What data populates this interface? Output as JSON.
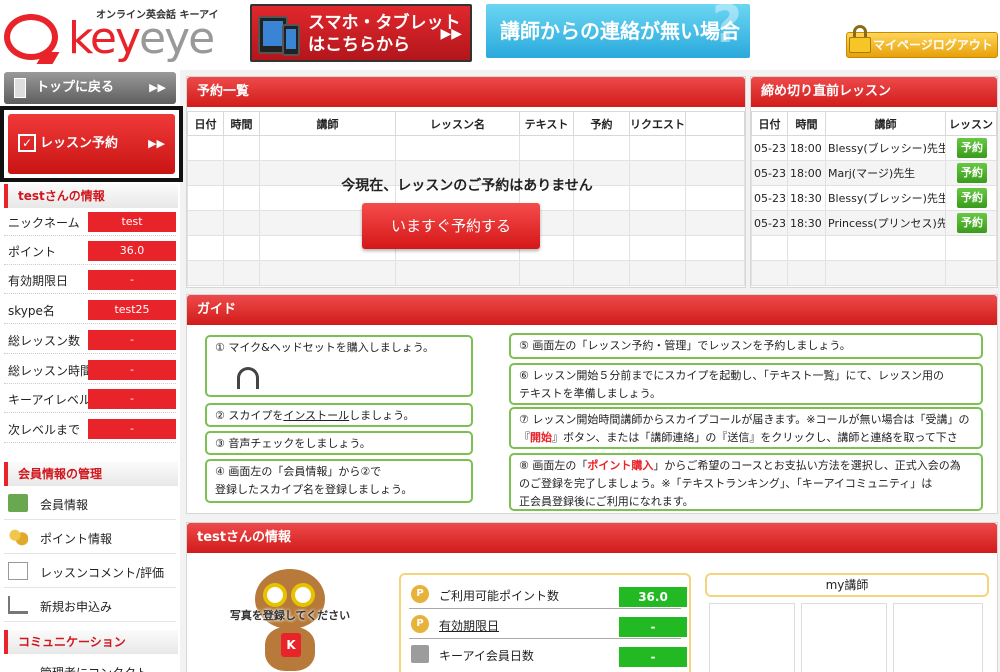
{
  "header": {
    "logo_tagline": "オンライン英会話 キーアイ",
    "logo_word_left": "key",
    "logo_word_right": "eye",
    "mobile_banner": [
      "スマホ・タブレット",
      "はこちらから"
    ],
    "contact_banner": "講師からの連絡が無い場合",
    "logout": "マイページログアウト"
  },
  "sidebar": {
    "top_button": "トップに戻る",
    "lesson_button": "レッスン予約",
    "user_info_title": "testさんの情報",
    "user_info": [
      {
        "label": "ニックネーム",
        "value": "test"
      },
      {
        "label": "ポイント",
        "value": "36.0"
      },
      {
        "label": "有効期限日",
        "value": "-"
      },
      {
        "label": "skype名",
        "value": "test25"
      },
      {
        "label": "総レッスン数",
        "value": "-"
      },
      {
        "label": "総レッスン時間",
        "value": "-"
      },
      {
        "label": "キーアイレベル",
        "value": "-"
      },
      {
        "label": "次レベルまで",
        "value": "-"
      }
    ],
    "member_title": "会員情報の管理",
    "member_menu": [
      {
        "label": "会員情報",
        "icon": "id-card-icon"
      },
      {
        "label": "ポイント情報",
        "icon": "coins-icon"
      },
      {
        "label": "レッスンコメント/評価",
        "icon": "pencil-note-icon"
      },
      {
        "label": "新規お申込み",
        "icon": "cart-icon"
      }
    ],
    "comm_title": "コミュニケーション",
    "comm_partial": "管理者にコンタクト"
  },
  "reservations": {
    "title": "予約一覧",
    "columns": [
      "日付",
      "時間",
      "講師",
      "レッスン名",
      "テキスト",
      "予約",
      "リクエスト"
    ],
    "empty_message": "今現在、レッスンのご予約はありません",
    "reserve_now": "いますぐ予約する"
  },
  "deadline": {
    "title": "締め切り直前レッスン",
    "columns": [
      "日付",
      "時間",
      "講師",
      "レッスン"
    ],
    "rows": [
      {
        "date": "05-23",
        "time": "18:00",
        "teacher": "Blessy(ブレッシー)先生",
        "action": "予約"
      },
      {
        "date": "05-23",
        "time": "18:00",
        "teacher": "Marj(マージ)先生",
        "action": "予約"
      },
      {
        "date": "05-23",
        "time": "18:30",
        "teacher": "Blessy(ブレッシー)先生",
        "action": "予約"
      },
      {
        "date": "05-23",
        "time": "18:30",
        "teacher": "Princess(プリンセス)先",
        "action": "予約"
      }
    ]
  },
  "guide": {
    "title": "ガイド",
    "s1": "① マイク&ヘッドセットを購入しましょう。",
    "s2_a": "② スカイプを",
    "s2_link": "インストール",
    "s2_b": "しましょう。",
    "s3": "③ 音声チェックをしましょう。",
    "s4_l1": "④ 画面左の「会員情報」から②で",
    "s4_l2": "登録したスカイプ名を登録しましょう。",
    "s5": "⑤ 画面左の「レッスン予約・管理」でレッスンを予約しましょう。",
    "s6_l1": "⑥ レッスン開始５分前までにスカイプを起動し、「テキスト一覧」にて、レッスン用の",
    "s6_l2": "テキストを準備しましょう。",
    "s7_l1": "⑦ レッスン開始時間講師からスカイプコールが届きます。※コールが無い場合は「受講」の",
    "s7_l2a": "『",
    "s7_red": "開始",
    "s7_l2b": "』ボタン、または「講師連絡」の『送信』をクリックし、講師と連絡を取って下さい。",
    "s8_a": "⑧ 画面左の「",
    "s8_red": "ポイント購入",
    "s8_b": "」からご希望のコースとお支払い方法を選択し、正式入会の為",
    "s8_l2": "のご登録を完了しましょう。※「テキストランキング」、「キーアイコミュニティ」は",
    "s8_l3": "正会員登録後にご利用になれます。"
  },
  "user_panel": {
    "title": "testさんの情報",
    "photo_prompt": "写真を登録してください",
    "points": [
      {
        "label": "ご利用可能ポイント数",
        "value": "36.0",
        "icon": "P"
      },
      {
        "label": "有効期限日",
        "value": "-",
        "icon": "P"
      },
      {
        "label": "キーアイ会員日数",
        "value": "-",
        "icon": ""
      }
    ],
    "my_teacher": "my講師"
  }
}
